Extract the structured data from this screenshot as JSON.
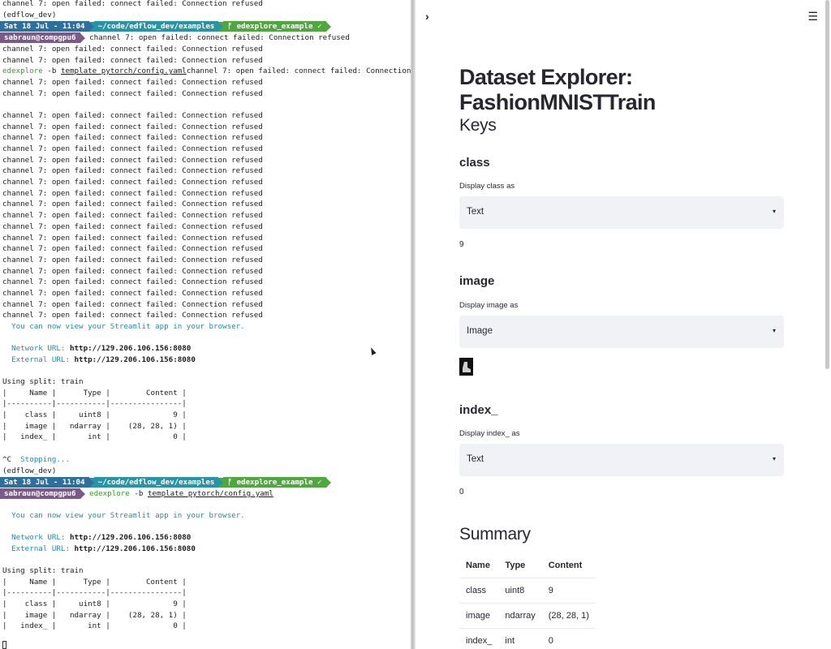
{
  "terminal": {
    "lines_top": [
      "channel 7: open failed: connect failed: Connection refused",
      "(edflow_dev)"
    ],
    "prompt1": {
      "date": "Sat 18 Jul - 11:04",
      "path": "~/code/edflow_dev/examples",
      "branch": "ᚠ edexplore_example ✓",
      "user": "sabraun@compgpu6",
      "rest": " channel 7: open failed: connect failed: Connection refused"
    },
    "after_prompt1": [
      "channel 7: open failed: connect failed: Connection refused",
      "channel 7: open failed: connect failed: Connection refused"
    ],
    "cmd1": {
      "bin": "edexplore",
      "args": " -b ",
      "file": "template_pytorch/config.yaml",
      "rest": "channel 7: open failed: connect failed: Connection refused"
    },
    "refused_block_a": [
      "channel 7: open failed: connect failed: Connection refused",
      "channel 7: open failed: connect failed: Connection refused",
      "",
      "channel 7: open failed: connect failed: Connection refused",
      "channel 7: open failed: connect failed: Connection refused",
      "channel 7: open failed: connect failed: Connection refused",
      "channel 7: open failed: connect failed: Connection refused",
      "channel 7: open failed: connect failed: Connection refused",
      "channel 7: open failed: connect failed: Connection refused",
      "channel 7: open failed: connect failed: Connection refused",
      "channel 7: open failed: connect failed: Connection refused",
      "channel 7: open failed: connect failed: Connection refused",
      "channel 7: open failed: connect failed: Connection refused",
      "channel 7: open failed: connect failed: Connection refused",
      "channel 7: open failed: connect failed: Connection refused",
      "channel 7: open failed: connect failed: Connection refused",
      "channel 7: open failed: connect failed: Connection refused",
      "channel 7: open failed: connect failed: Connection refused",
      "channel 7: open failed: connect failed: Connection refused",
      "channel 7: open failed: connect failed: Connection refused",
      "channel 7: open failed: connect failed: Connection refused",
      "channel 7: open failed: connect failed: Connection refused"
    ],
    "streamlit_msg": "  You can now view your Streamlit app in your browser.",
    "network_label": "  Network URL: ",
    "network_url": "http://129.206.106.156:8080",
    "external_label": "  External URL: ",
    "external_url": "http://129.206.106.156:8080",
    "split_table": [
      "Using split: train",
      "|     Name |      Type |        Content |",
      "|----------|-----------|----------------|",
      "|    class |     uint8 |              9 |",
      "|    image |   ndarray |    (28, 28, 1) |",
      "|   index_ |       int |              0 |"
    ],
    "split_table2": [
      "Using split: train",
      "|     Name |      Type |        Content |",
      "|----------|-----------|----------------|",
      "|    class |     uint8 |              9 |",
      "|    image |   ndarray |    (28, 28, 1) |",
      "|   index_ |       int |              0 |"
    ],
    "interrupt": "^C",
    "stopping": "  Stopping...",
    "env": "(edflow_dev)",
    "prompt2": {
      "date": "Sat 18 Jul - 11:04",
      "path": "~/code/edflow_dev/examples",
      "branch": "ᚠ edexplore_example ✓",
      "user": "sabraun@compgpu6",
      "bin": " edexplore",
      "args": " -b ",
      "file": "template_pytorch/config.yaml"
    }
  },
  "app": {
    "title": "Dataset Explorer: FashionMNISTTrain",
    "sidebar_toggle": "›",
    "menu": "☰",
    "keys_header": "Keys",
    "keys": [
      {
        "name": "class",
        "label": "Display class as",
        "selected": "Text",
        "value": "9"
      },
      {
        "name": "image",
        "label": "Display image as",
        "selected": "Image",
        "value": ""
      },
      {
        "name": "index_",
        "label": "Display index_ as",
        "selected": "Text",
        "value": "0"
      }
    ],
    "caret": "▾",
    "summary_header": "Summary",
    "summary": {
      "columns": [
        "Name",
        "Type",
        "Content"
      ],
      "rows": [
        [
          "class",
          "uint8",
          "9"
        ],
        [
          "image",
          "ndarray",
          "(28, 28, 1)"
        ],
        [
          "index_",
          "int",
          "0"
        ]
      ]
    }
  },
  "colors": {
    "prompt_date": "#2e6f9e",
    "prompt_path": "#2895a6",
    "prompt_branch": "#4fa83d",
    "prompt_user": "#7b5a8a",
    "selectbox_bg": "#f0f2f6",
    "text": "#262730"
  }
}
